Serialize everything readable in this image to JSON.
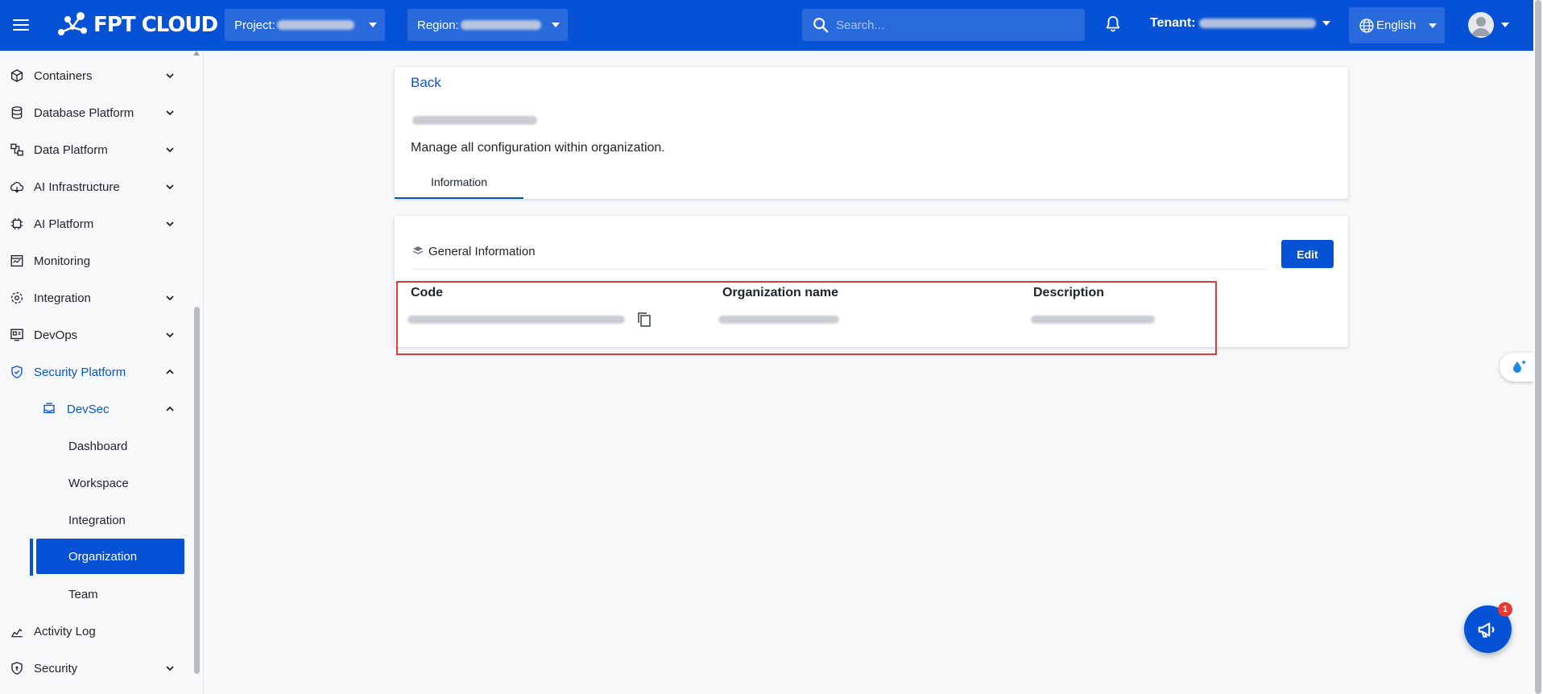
{
  "header": {
    "logo_text": "FPT CLOUD",
    "project_label": "Project:",
    "region_label": "Region:",
    "search_placeholder": "Search...",
    "tenant_label": "Tenant:",
    "language": "English"
  },
  "sidebar": {
    "items": [
      {
        "label": "Containers",
        "icon": "cube-icon"
      },
      {
        "label": "Database Platform",
        "icon": "database-icon"
      },
      {
        "label": "Data Platform",
        "icon": "data-platform-icon"
      },
      {
        "label": "AI Infrastructure",
        "icon": "cloud-icon"
      },
      {
        "label": "AI Platform",
        "icon": "chip-icon"
      },
      {
        "label": "Monitoring",
        "icon": "monitor-icon"
      },
      {
        "label": "Integration",
        "icon": "integration-icon"
      },
      {
        "label": "DevOps",
        "icon": "devops-icon"
      },
      {
        "label": "Security Platform",
        "icon": "shield-icon"
      },
      {
        "label": "DevSec",
        "icon": "devsec-icon"
      },
      {
        "label": "Activity Log",
        "icon": "activity-log-icon"
      },
      {
        "label": "Security",
        "icon": "security-shield-icon"
      }
    ],
    "devsec_children": [
      "Dashboard",
      "Workspace",
      "Integration",
      "Organization",
      "Team"
    ]
  },
  "main": {
    "back_label": "Back",
    "description": "Manage all configuration within organization.",
    "tab_information": "Information",
    "general_info_title": "General Information",
    "edit_label": "Edit",
    "columns": {
      "code": "Code",
      "organization_name": "Organization name",
      "description": "Description"
    }
  },
  "notification_badge": "1",
  "colors": {
    "brand": "#0552d6",
    "highlight": "#e53935"
  }
}
